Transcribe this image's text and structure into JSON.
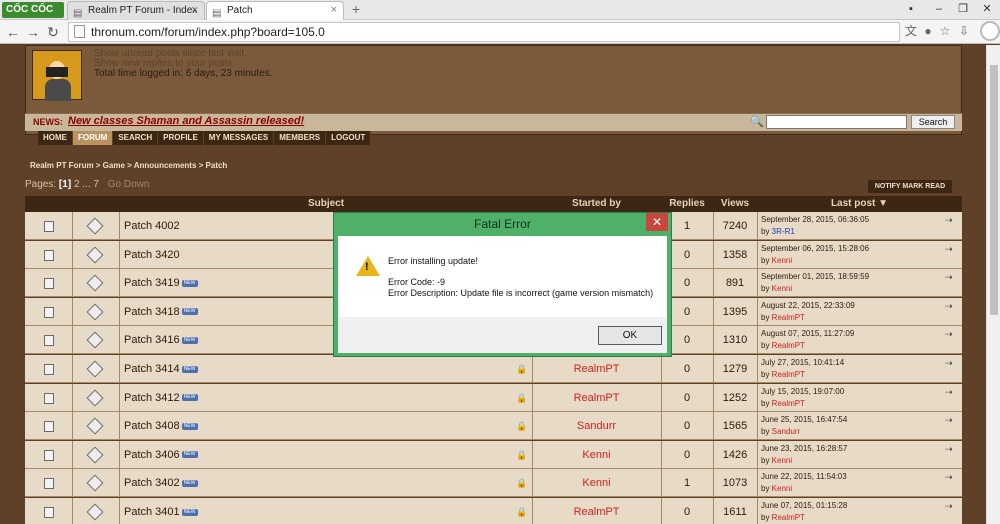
{
  "browser": {
    "logo": "CỐC CỐC",
    "tabs": [
      {
        "label": "Realm PT Forum - Index"
      },
      {
        "label": "Patch"
      }
    ],
    "url": "thronum.com/forum/index.php?board=105.0"
  },
  "user": {
    "line1": "Show unread posts since last visit.",
    "line2": "Show new replies to your posts.",
    "line3": "Total time logged in: 6 days, 23 minutes."
  },
  "news": {
    "label": "NEWS:",
    "text": "New classes Shaman and Assassin released!"
  },
  "search": {
    "button": "Search"
  },
  "menu": [
    "HOME",
    "FORUM",
    "SEARCH",
    "PROFILE",
    "MY MESSAGES",
    "MEMBERS",
    "LOGOUT"
  ],
  "breadcrumb": "Realm PT Forum > Game > Announcements > Patch",
  "pages": {
    "label": "Pages: ",
    "current": "[1]",
    "rest": "2 ... 7",
    "go": "Go Down"
  },
  "notify": "NOTIFY   MARK READ",
  "table": {
    "headers": {
      "subject": "Subject",
      "started": "Started by",
      "replies": "Replies",
      "views": "Views",
      "last": "Last post ▼"
    },
    "rows": [
      {
        "subject": "Patch 4002",
        "new": false,
        "starter": "",
        "replies": "1",
        "views": "7240",
        "date": "September 28, 2015, 06:36:05",
        "by": "3R-R1",
        "byBlue": true
      },
      {
        "subject": "Patch 3420",
        "new": false,
        "starter": "",
        "replies": "0",
        "views": "1358",
        "date": "September 06, 2015, 15:28:06",
        "by": "Kenni",
        "byBlue": false
      },
      {
        "subject": "Patch 3419",
        "new": true,
        "starter": "",
        "replies": "0",
        "views": "891",
        "date": "September 01, 2015, 18:59:59",
        "by": "Kenni",
        "byBlue": false
      },
      {
        "subject": "Patch 3418",
        "new": true,
        "starter": "",
        "replies": "0",
        "views": "1395",
        "date": "August 22, 2015, 22:33:09",
        "by": "RealmPT",
        "byBlue": false
      },
      {
        "subject": "Patch 3416",
        "new": true,
        "starter": "",
        "replies": "0",
        "views": "1310",
        "date": "August 07, 2015, 11:27:09",
        "by": "RealmPT",
        "byBlue": false
      },
      {
        "subject": "Patch 3414",
        "new": true,
        "starter": "RealmPT",
        "replies": "0",
        "views": "1279",
        "date": "July 27, 2015, 10:41:14",
        "by": "RealmPT",
        "byBlue": false
      },
      {
        "subject": "Patch 3412",
        "new": true,
        "starter": "RealmPT",
        "replies": "0",
        "views": "1252",
        "date": "July 15, 2015, 19:07:00",
        "by": "RealmPT",
        "byBlue": false
      },
      {
        "subject": "Patch 3408",
        "new": true,
        "starter": "Sandurr",
        "replies": "0",
        "views": "1565",
        "date": "June 25, 2015, 16:47:54",
        "by": "Sandurr",
        "byBlue": false
      },
      {
        "subject": "Patch 3406",
        "new": true,
        "starter": "Kenni",
        "replies": "0",
        "views": "1426",
        "date": "June 23, 2015, 16:28:57",
        "by": "Kenni",
        "byBlue": false
      },
      {
        "subject": "Patch 3402",
        "new": true,
        "starter": "Kenni",
        "replies": "1",
        "views": "1073",
        "date": "June 22, 2015, 11:54:03",
        "by": "Kenni",
        "byBlue": false
      },
      {
        "subject": "Patch 3401",
        "new": true,
        "starter": "RealmPT",
        "replies": "0",
        "views": "1611",
        "date": "June 07, 2015, 01:15:28",
        "by": "RealmPT",
        "byBlue": false
      }
    ],
    "by_prefix": "by ",
    "new_badge": "NEW"
  },
  "dialog": {
    "title": "Fatal Error",
    "line1": "Error installing update!",
    "line2": "Error Code: -9",
    "line3": "Error Description: Update file is incorrect (game version mismatch)",
    "ok": "OK"
  }
}
